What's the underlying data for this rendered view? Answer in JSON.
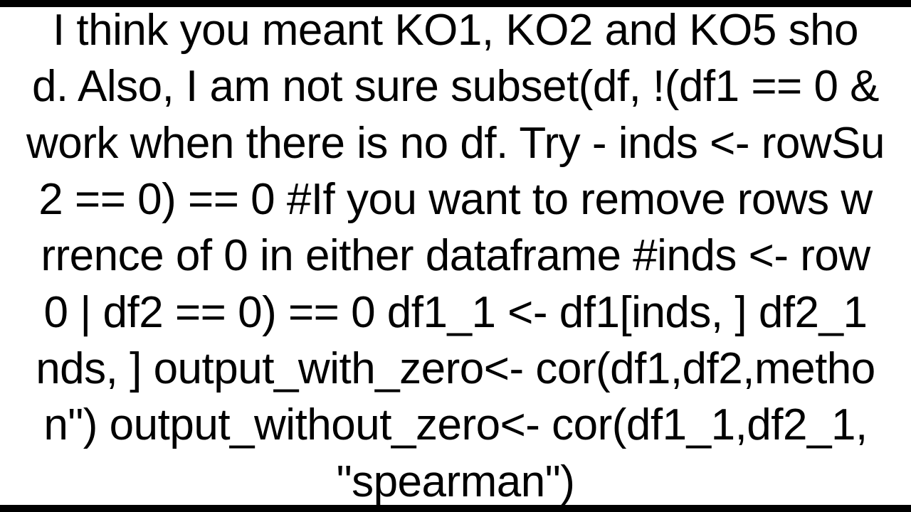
{
  "lines": {
    "l1": " I think you meant KO1, KO2 and KO5 sho",
    "l2": "d. Also, I am not sure subset(df, !(df1 == 0 &",
    "l3": "work when there is no df. Try - inds <- rowSu",
    "l4": "2 == 0) == 0 #If you want to remove rows w",
    "l5": "rrence of 0 in either dataframe #inds <- row",
    "l6": "0 | df2 == 0) == 0  df1_1 <- df1[inds, ] df2_1",
    "l7": "nds, ] output_with_zero<- cor(df1,df2,metho",
    "l8": "n\") output_without_zero<- cor(df1_1,df2_1,",
    "l9": "\"spearman\")"
  }
}
